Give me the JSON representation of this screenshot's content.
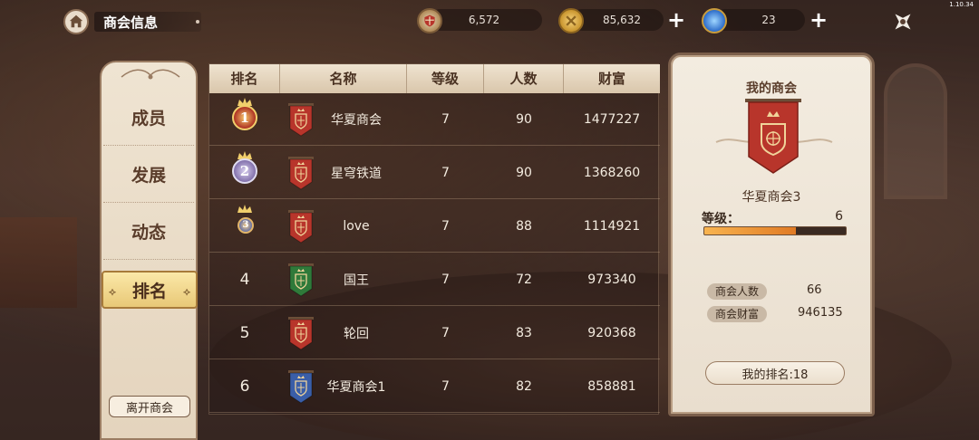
{
  "version": "1.10.34",
  "header": {
    "title": "商会信息"
  },
  "resources": [
    {
      "icon": "guild-shield-icon",
      "value": "6,572",
      "has_plus": false
    },
    {
      "icon": "gold-coin-icon",
      "value": "85,632",
      "has_plus": true
    },
    {
      "icon": "blue-gem-icon",
      "value": "23",
      "has_plus": true
    }
  ],
  "menu": {
    "items": [
      {
        "label": "成员",
        "active": false
      },
      {
        "label": "发展",
        "active": false
      },
      {
        "label": "动态",
        "active": false
      },
      {
        "label": "排名",
        "active": true
      }
    ],
    "leave_label": "离开商会"
  },
  "ranking": {
    "headers": [
      "排名",
      "名称",
      "等级",
      "人数",
      "财富"
    ],
    "rows": [
      {
        "rank": "1",
        "medal": "gold",
        "banner_color": "#b8352b",
        "name": "华夏商会",
        "level": "7",
        "members": "90",
        "wealth": "1477227"
      },
      {
        "rank": "2",
        "medal": "silver",
        "banner_color": "#b8352b",
        "name": "星穹铁道",
        "level": "7",
        "members": "90",
        "wealth": "1368260"
      },
      {
        "rank": "3",
        "medal": "bronze",
        "banner_color": "#b8352b",
        "name": "love",
        "level": "7",
        "members": "88",
        "wealth": "1114921"
      },
      {
        "rank": "4",
        "medal": "",
        "banner_color": "#2f7a3a",
        "name": "国王",
        "level": "7",
        "members": "72",
        "wealth": "973340"
      },
      {
        "rank": "5",
        "medal": "",
        "banner_color": "#b8352b",
        "name": "轮回",
        "level": "7",
        "members": "83",
        "wealth": "920368"
      },
      {
        "rank": "6",
        "medal": "",
        "banner_color": "#3a5ea8",
        "name": "华夏商会1",
        "level": "7",
        "members": "82",
        "wealth": "858881"
      }
    ]
  },
  "my_guild": {
    "title": "我的商会",
    "name": "华夏商会3",
    "level_label": "等级：",
    "level_value": "6",
    "level_progress": 0.65,
    "members_label": "商会人数",
    "members_value": "66",
    "wealth_label": "商会财富",
    "wealth_value": "946135",
    "my_rank_label": "我的排名:18"
  },
  "colors": {
    "accent_gold": "#e8c877",
    "banner_red": "#b8352b",
    "panel_bg": "#f3ece0"
  }
}
